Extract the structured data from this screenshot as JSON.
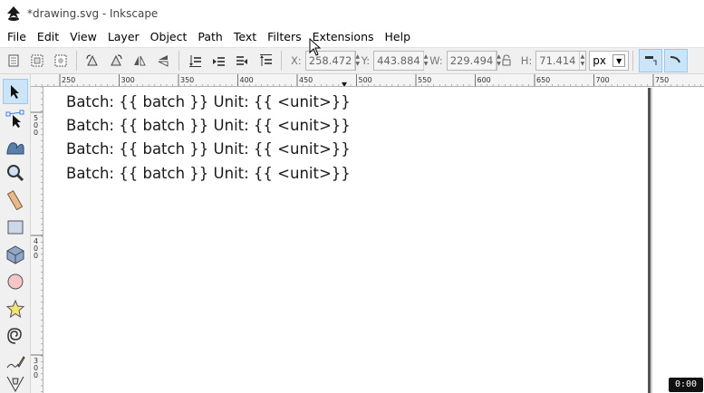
{
  "window": {
    "title": "*drawing.svg - Inkscape"
  },
  "menu": [
    "File",
    "Edit",
    "View",
    "Layer",
    "Object",
    "Path",
    "Text",
    "Filters",
    "Extensions",
    "Help"
  ],
  "toolbar": {
    "x_label": "X:",
    "x_value": "258.472",
    "y_label": "Y:",
    "y_value": "443.884",
    "w_label": "W:",
    "w_value": "229.494",
    "h_label": "H:",
    "h_value": "71.414",
    "unit": "px"
  },
  "rulers": {
    "horizontal_ticks": [
      "250",
      "300",
      "350",
      "400",
      "450",
      "500",
      "550",
      "600",
      "650",
      "700",
      "750"
    ],
    "vertical_ticks": [
      "500",
      "400",
      "300"
    ]
  },
  "canvas": {
    "lines": [
      "Batch: {{ batch }} Unit: {{ <unit>}}",
      "Batch: {{ batch }} Unit: {{ <unit>}}",
      "Batch: {{ batch }} Unit: {{ <unit>}}",
      "Batch: {{ batch }} Unit: {{ <unit>}}"
    ]
  },
  "status": {
    "badge": "0:00"
  },
  "tools": [
    "selector-tool",
    "node-tool",
    "tweak-tool",
    "zoom-tool",
    "measure-tool",
    "rectangle-tool",
    "3d-box-tool",
    "ellipse-tool",
    "star-tool",
    "spiral-tool",
    "pencil-tool",
    "pen-tool"
  ]
}
